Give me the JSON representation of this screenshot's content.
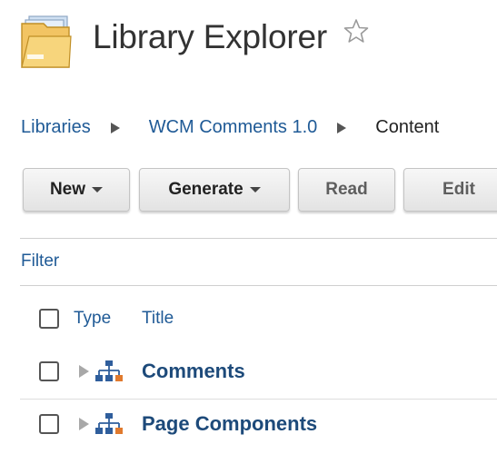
{
  "header": {
    "title": "Library Explorer",
    "folder_icon": "folder-icon",
    "favorite_icon": "star-icon"
  },
  "breadcrumb": {
    "items": [
      {
        "label": "Libraries",
        "type": "link"
      },
      {
        "label": "WCM Comments 1.0",
        "type": "link"
      },
      {
        "label": "Content",
        "type": "current"
      }
    ],
    "separator_icon": "triangle-right-icon"
  },
  "toolbar": {
    "new_label": "New",
    "generate_label": "Generate",
    "read_label": "Read",
    "edit_label": "Edit"
  },
  "filter": {
    "label": "Filter"
  },
  "table": {
    "columns": {
      "type": "Type",
      "title": "Title"
    },
    "rows": [
      {
        "title": "Comments",
        "icon": "site-area-icon",
        "expandable": true,
        "checked": false
      },
      {
        "title": "Page Components",
        "icon": "site-area-icon",
        "expandable": true,
        "checked": false
      }
    ]
  },
  "colors": {
    "link": "#1f5a96",
    "row_title": "#1d4a7a",
    "heading": "#333333",
    "icon_blue": "#2f5e9c",
    "icon_orange": "#e07a2e"
  }
}
